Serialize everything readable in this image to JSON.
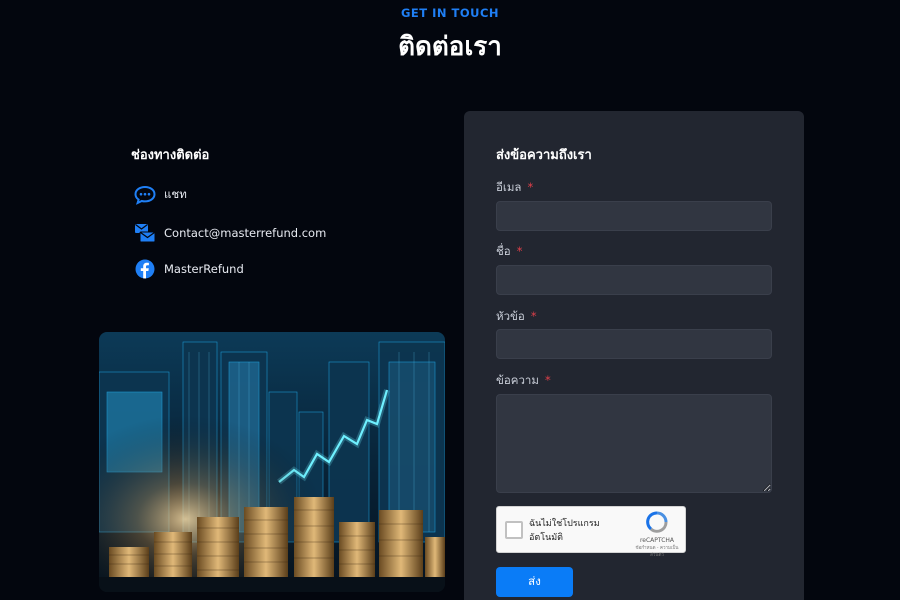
{
  "header": {
    "eyebrow": "GET IN TOUCH",
    "title": "ติดต่อเรา"
  },
  "contact": {
    "heading": "ช่องทางติดต่อ",
    "items": [
      {
        "icon": "chat-bubble-icon",
        "label": "แชท"
      },
      {
        "icon": "mail-icon",
        "label": "Contact@masterrefund.com"
      },
      {
        "icon": "facebook-icon",
        "label": "MasterRefund"
      }
    ]
  },
  "form": {
    "heading": "ส่งข้อความถึงเรา",
    "fields": [
      {
        "label": "อีเมล",
        "required_mark": "*",
        "value": "",
        "placeholder": ""
      },
      {
        "label": "ชื่อ",
        "required_mark": "*",
        "value": "",
        "placeholder": ""
      },
      {
        "label": "หัวข้อ",
        "required_mark": "*",
        "value": "",
        "placeholder": ""
      },
      {
        "label": "ข้อความ",
        "required_mark": "*",
        "value": "",
        "placeholder": ""
      }
    ],
    "recaptcha": {
      "label": "ฉันไม่ใช่โปรแกรมอัตโนมัติ",
      "brand": "reCAPTCHA",
      "links": "ข้อกำหนด - ความเป็นส่วนตัว"
    },
    "submit_label": "ส่ง"
  },
  "colors": {
    "background": "#03060e",
    "accent": "#0a7cf7",
    "card": "#222630",
    "required": "#e0404a"
  }
}
